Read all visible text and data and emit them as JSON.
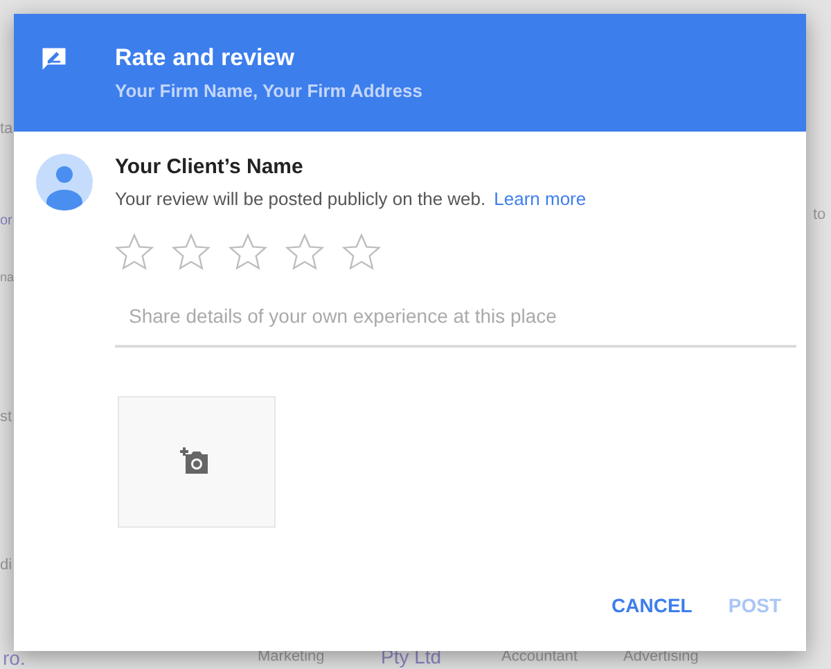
{
  "background": {
    "fragments": [
      {
        "text": "ta",
        "kind": "small"
      },
      {
        "text": "or",
        "kind": "link"
      },
      {
        "text": "na",
        "kind": "small"
      },
      {
        "text": "st",
        "kind": "small"
      },
      {
        "text": "di",
        "kind": "small"
      },
      {
        "text": "ro.",
        "kind": "link"
      },
      {
        "text": "to",
        "kind": "small"
      },
      {
        "text": "Marketing",
        "kind": "small"
      },
      {
        "text": "Pty Ltd",
        "kind": "link"
      },
      {
        "text": "Accountant",
        "kind": "small"
      },
      {
        "text": "Advertising",
        "kind": "small"
      }
    ]
  },
  "dialog": {
    "title": "Rate and review",
    "subtitle": "Your Firm Name, Your Firm Address",
    "reviewer": {
      "name": "Your Client’s Name",
      "notice": "Your review will be posted publicly on the web.",
      "link": "Learn more"
    },
    "rating": {
      "stars": 0
    },
    "review_field": {
      "placeholder": "Share details of your own experience at this place"
    },
    "buttons": [
      {
        "label": "CANCEL",
        "disabled": false
      },
      {
        "label": "POST",
        "disabled": true
      }
    ]
  }
}
